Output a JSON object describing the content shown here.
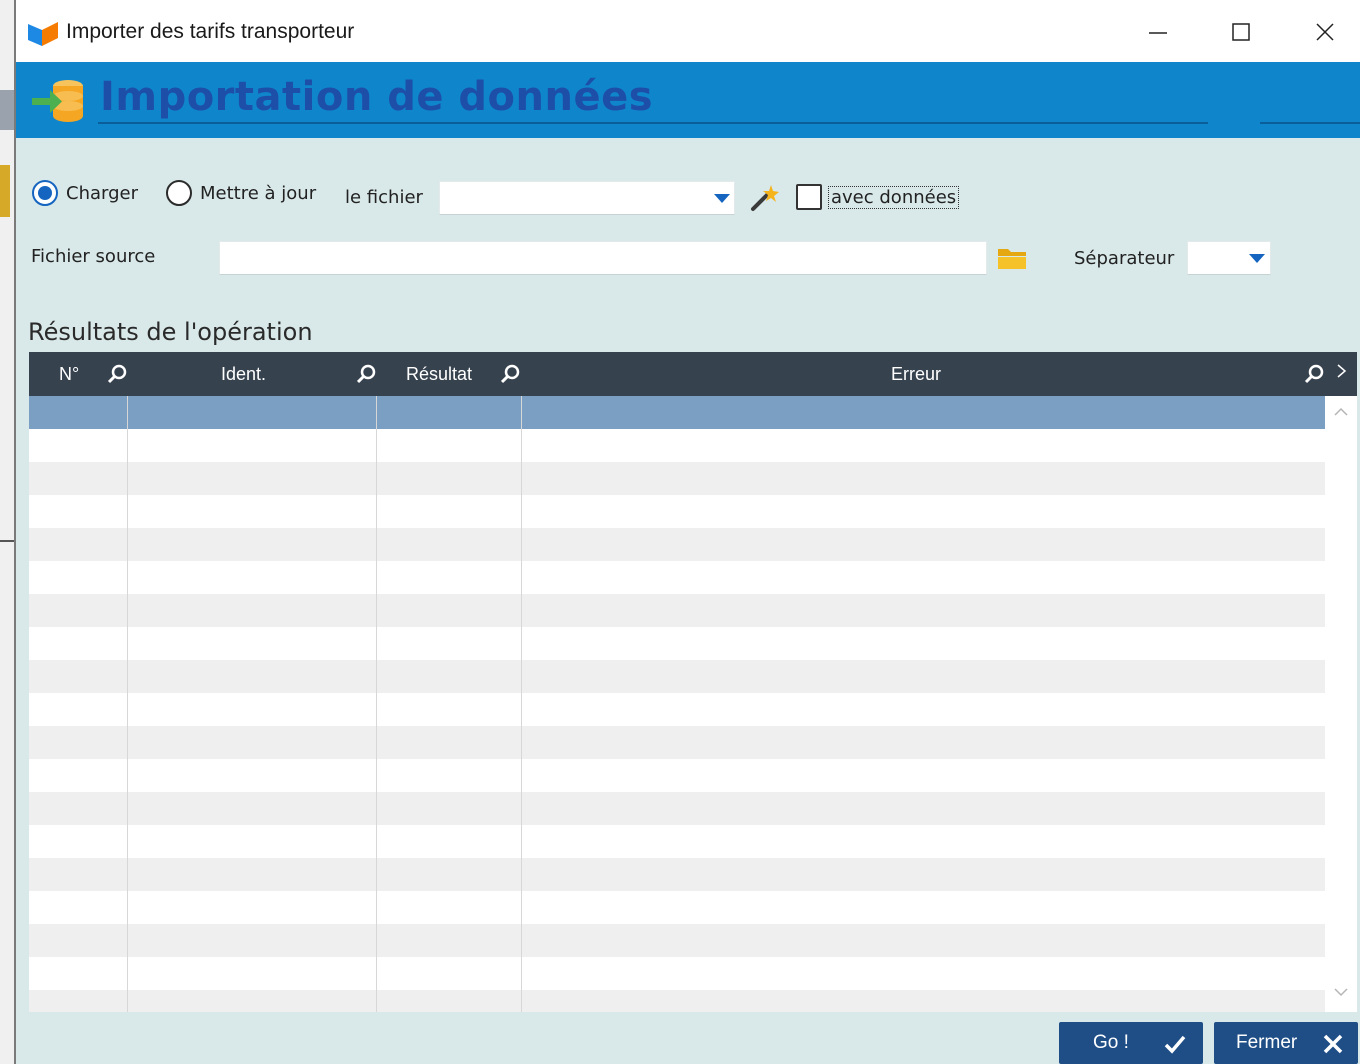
{
  "window": {
    "title": "Importer des tarifs transporteur"
  },
  "header": {
    "title": "Importation de données"
  },
  "form": {
    "radio_charger": {
      "label": "Charger",
      "checked": true
    },
    "radio_maj": {
      "label": "Mettre à jour",
      "checked": false
    },
    "fichier_label": "le fichier",
    "fichier_value": "",
    "avec_donnees": {
      "label": "avec données",
      "checked": false
    },
    "source_label": "Fichier source",
    "source_value": "",
    "separateur_label": "Séparateur",
    "separateur_value": ""
  },
  "results": {
    "title": "Résultats de l'opération",
    "columns": [
      "N°",
      "Ident.",
      "Résultat",
      "Erreur"
    ],
    "rows": []
  },
  "buttons": {
    "go": "Go !",
    "close": "Fermer"
  },
  "colors": {
    "header_band": "#0f86cc",
    "header_title": "#1d4fa8",
    "window_bg": "#d9e8e8",
    "grid_head": "#37424f",
    "selected_row": "#7b9fc3",
    "button": "#1f4e86"
  }
}
